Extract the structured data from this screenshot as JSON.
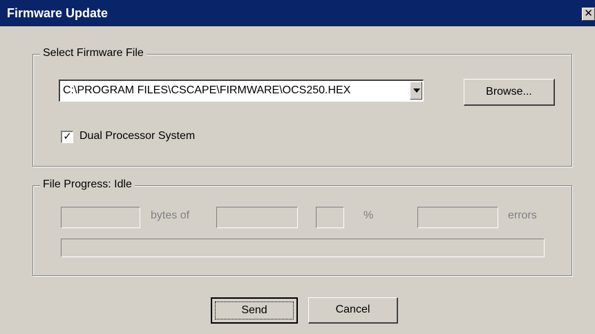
{
  "window": {
    "title": "Firmware Update",
    "close_glyph": "✕"
  },
  "select_group": {
    "legend": "Select Firmware File",
    "file_path": "C:\\PROGRAM FILES\\CSCAPE\\FIRMWARE\\OCS250.HEX",
    "browse_label": "Browse...",
    "dual_processor_label": "Dual Processor System",
    "dual_processor_checked": true,
    "check_glyph": "✓"
  },
  "progress_group": {
    "legend": "File Progress:  Idle",
    "bytes_label": "bytes  of",
    "percent_label": "%",
    "errors_label": "errors",
    "bytes_value": "",
    "total_value": "",
    "percent_value": "",
    "errors_value": "",
    "progress": 0
  },
  "buttons": {
    "send": "Send",
    "cancel": "Cancel"
  },
  "colors": {
    "titlebar": "#0a246a",
    "face": "#d4d0c8",
    "disabled_text": "#808080"
  },
  "icons": {
    "close": "close-icon",
    "dropdown": "chevron-down-icon",
    "check": "checkmark-icon"
  }
}
